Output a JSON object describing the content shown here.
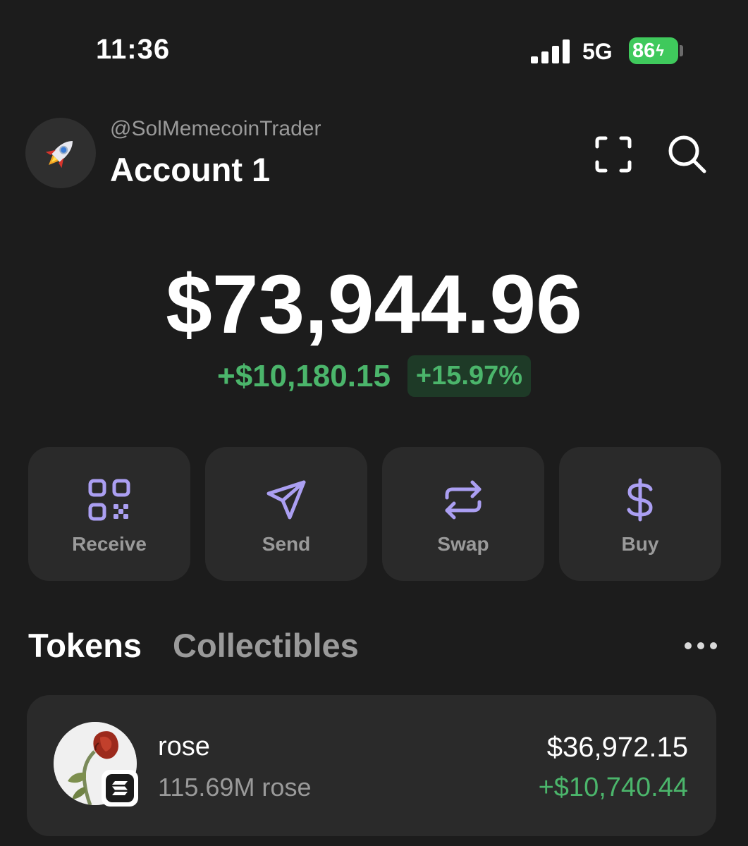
{
  "status_bar": {
    "time": "11:36",
    "network": "5G",
    "battery": "86",
    "battery_color": "#3fc95c"
  },
  "account": {
    "avatar_icon": "rocket-icon",
    "username": "@SolMemecoinTrader",
    "name": "Account 1"
  },
  "header_actions": {
    "scan_icon": "scan-icon",
    "search_icon": "search-icon"
  },
  "balance": {
    "total": "$73,944.96",
    "change_amount": "+$10,180.15",
    "change_percent": "+15.97%",
    "positive_color": "#4bb56b"
  },
  "actions": [
    {
      "label": "Receive",
      "icon": "qr-code-icon"
    },
    {
      "label": "Send",
      "icon": "send-icon"
    },
    {
      "label": "Swap",
      "icon": "swap-icon"
    },
    {
      "label": "Buy",
      "icon": "dollar-icon"
    }
  ],
  "accent_color": "#ab9ff2",
  "tabs": [
    {
      "label": "Tokens",
      "active": true
    },
    {
      "label": "Collectibles",
      "active": false
    }
  ],
  "more_icon": "more-icon",
  "tokens": [
    {
      "name": "rose",
      "amount": "115.69M rose",
      "value": "$36,972.15",
      "change": "+$10,740.44",
      "logo_icon": "rose-icon",
      "chain_icon": "solana-icon"
    }
  ]
}
